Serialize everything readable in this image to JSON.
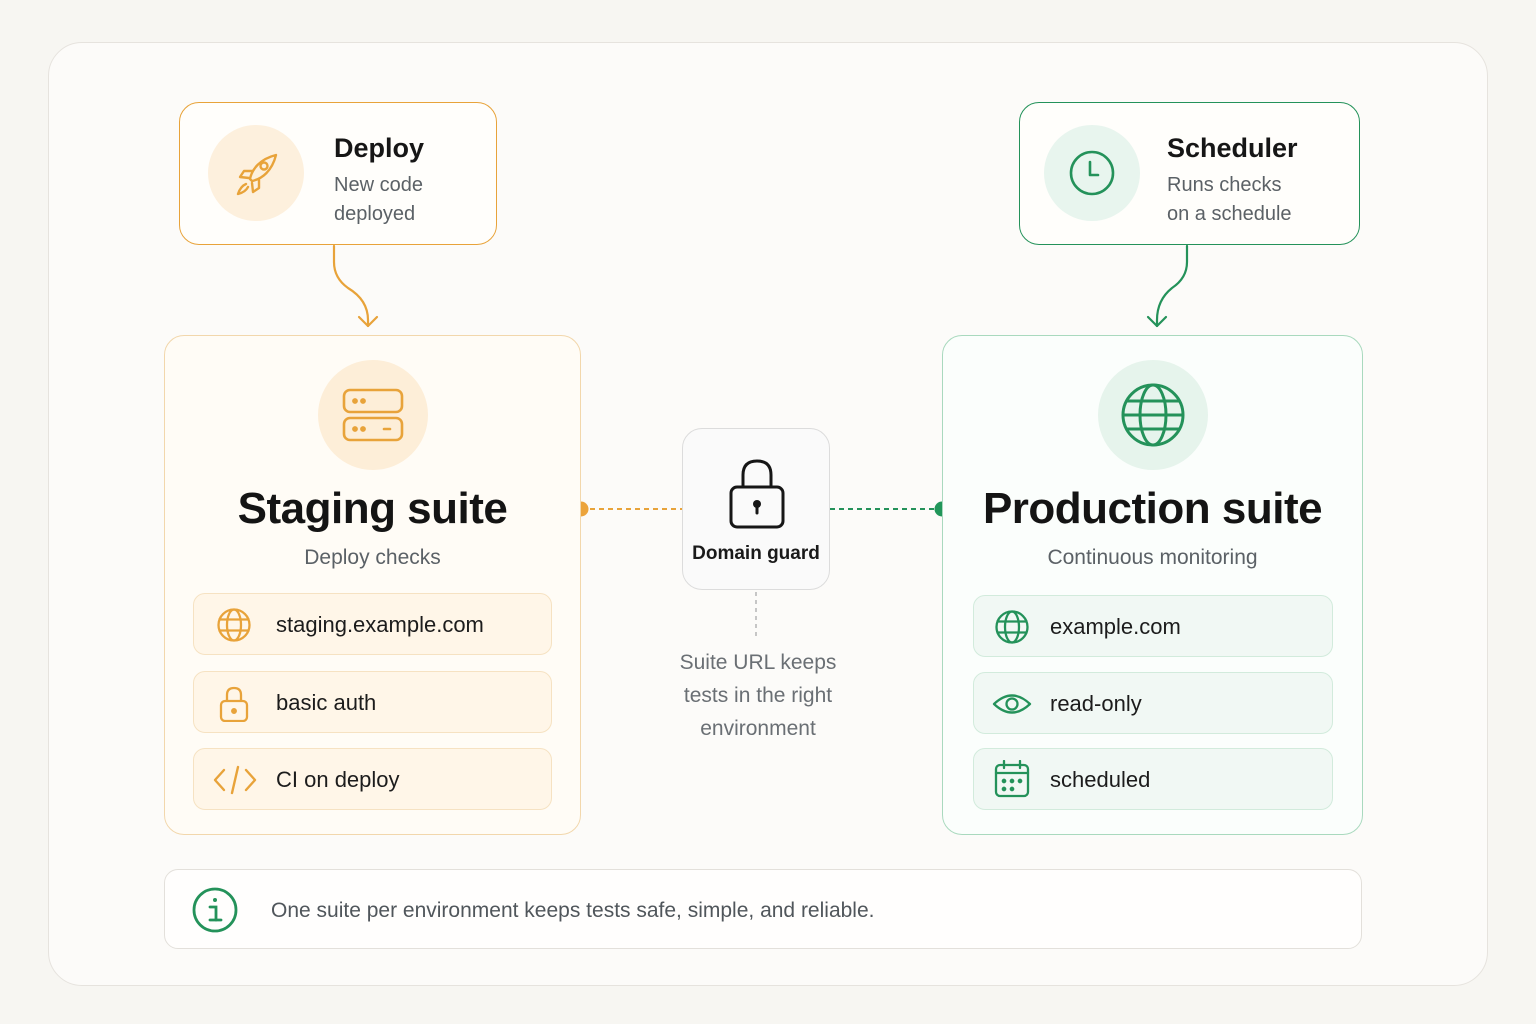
{
  "colors": {
    "staging_accent": "#e8a33a",
    "production_accent": "#24925a",
    "neutral_border": "#e3e0db"
  },
  "deploy": {
    "title": "Deploy",
    "desc_line1": "New code",
    "desc_line2": "deployed",
    "icon": "rocket-icon"
  },
  "scheduler": {
    "title": "Scheduler",
    "desc_line1": "Runs checks",
    "desc_line2": "on a schedule",
    "icon": "clock-icon"
  },
  "staging": {
    "title": "Staging suite",
    "subtitle": "Deploy checks",
    "icon": "server-icon",
    "items": [
      {
        "label": "staging.example.com",
        "icon": "globe-icon"
      },
      {
        "label": "basic auth",
        "icon": "lock-icon"
      },
      {
        "label": "CI on deploy",
        "icon": "code-icon"
      }
    ]
  },
  "production": {
    "title": "Production suite",
    "subtitle": "Continuous monitoring",
    "icon": "globe-icon",
    "items": [
      {
        "label": "example.com",
        "icon": "globe-icon"
      },
      {
        "label": "read-only",
        "icon": "eye-icon"
      },
      {
        "label": "scheduled",
        "icon": "calendar-icon"
      }
    ]
  },
  "guard": {
    "label": "Domain guard",
    "icon": "padlock-icon",
    "note_line1": "Suite URL keeps",
    "note_line2": "tests in the right",
    "note_line3": "environment"
  },
  "footer": {
    "text": "One suite per environment keeps tests safe, simple, and reliable.",
    "icon": "info-icon"
  }
}
